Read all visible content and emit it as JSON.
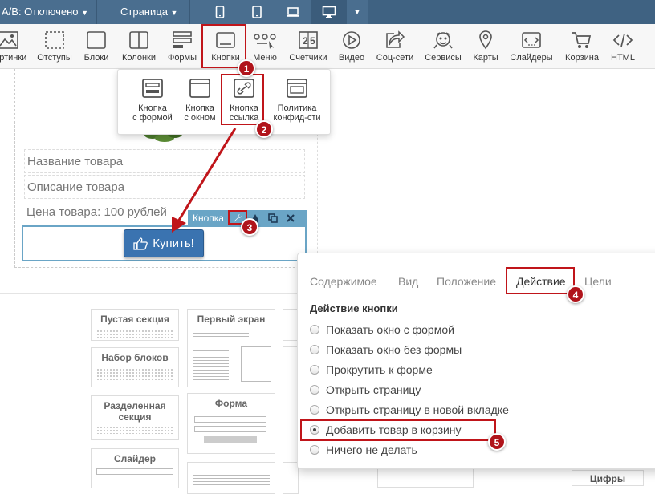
{
  "topbar": {
    "ab_label": "A/B: Отключено",
    "page_label": "Страница",
    "devices": [
      "phone",
      "phone-large",
      "laptop",
      "desktop"
    ]
  },
  "toolbar": {
    "items": [
      {
        "label": "Картинки",
        "icon": "image-icon"
      },
      {
        "label": "Отступы",
        "icon": "padding-icon"
      },
      {
        "label": "Блоки",
        "icon": "block-icon"
      },
      {
        "label": "Колонки",
        "icon": "columns-icon"
      },
      {
        "label": "Формы",
        "icon": "form-icon"
      },
      {
        "label": "Кнопки",
        "icon": "button-icon"
      },
      {
        "label": "Меню",
        "icon": "menu-icon"
      },
      {
        "label": "Счетчики",
        "icon": "counter-icon"
      },
      {
        "label": "Видео",
        "icon": "video-icon"
      },
      {
        "label": "Соц-сети",
        "icon": "share-icon"
      },
      {
        "label": "Сервисы",
        "icon": "services-icon"
      },
      {
        "label": "Карты",
        "icon": "map-icon"
      },
      {
        "label": "Слайдеры",
        "icon": "slider-icon"
      },
      {
        "label": "Корзина",
        "icon": "cart-icon"
      },
      {
        "label": "HTML",
        "icon": "code-icon"
      }
    ]
  },
  "dropdown": {
    "items": [
      {
        "label_1": "Кнопка",
        "label_2": "с формой"
      },
      {
        "label_1": "Кнопка",
        "label_2": "с окном"
      },
      {
        "label_1": "Кнопка",
        "label_2": "ссылка"
      },
      {
        "label_1": "Политика",
        "label_2": "конфид-сти"
      }
    ]
  },
  "product": {
    "name": "Название товара",
    "description": "Описание товара",
    "price": "Цена товара: 100 рублей",
    "buy_label": "Купить!"
  },
  "element_toolbar": {
    "label": "Кнопка"
  },
  "library": {
    "blocks": [
      "Пустая секция",
      "Набор блоков",
      "Разделенная секция",
      "Слайдер",
      "Первый экран",
      "Форма"
    ],
    "cut_label": "Цифры"
  },
  "panel": {
    "tabs": [
      "Содержимое",
      "Вид",
      "Положение",
      "Действие",
      "Цели"
    ],
    "active_tab": "Действие",
    "title": "Действие кнопки",
    "options": [
      "Показать окно с формой",
      "Показать окно без формы",
      "Прокрутить к форме",
      "Открыть страницу",
      "Открыть страницу в новой вкладке",
      "Добавить товар в корзину",
      "Ничего не делать"
    ],
    "selected_option": "Добавить товар в корзину"
  },
  "annotations": [
    "1",
    "2",
    "3",
    "4",
    "5"
  ],
  "colors": {
    "topbar": "#4a6e8f",
    "accent": "#3a73b0",
    "highlight": "#c0151a",
    "element_bar": "#6aa5c6"
  }
}
